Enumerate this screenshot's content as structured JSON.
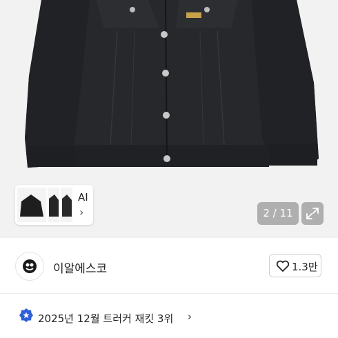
{
  "gallery": {
    "thumb_label": "AI",
    "counter": "2 / 11"
  },
  "seller": {
    "name": "이알에스코",
    "likes": "1.3만"
  },
  "ranking": {
    "text": "2025년 12월 트러커 재킷 3위"
  },
  "icons": {
    "expand": "expand-icon",
    "heart": "heart-icon",
    "badge": "badge-icon",
    "chevron": "chevron-right-icon"
  },
  "colors": {
    "badge_blue": "#2f5fd8",
    "jacket": "#222427"
  }
}
